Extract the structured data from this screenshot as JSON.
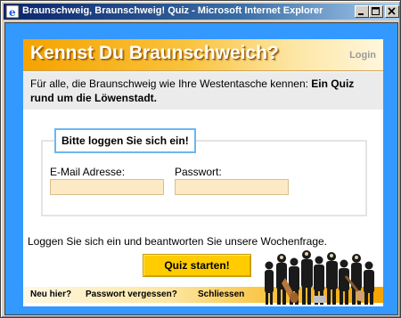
{
  "window": {
    "title": "Braunschweig, Braunschweig! Quiz - Microsoft Internet Explorer"
  },
  "header": {
    "title": "Kennst Du Braunschweich?",
    "login_link": "Login"
  },
  "intro": {
    "text": "Für alle, die Braunschweig wie Ihre Westentasche kennen: ",
    "bold": "Ein Quiz rund um die Löwenstadt."
  },
  "login": {
    "legend": "Bitte loggen Sie sich ein!",
    "email_label": "E-Mail Adresse:",
    "email_value": "",
    "password_label": "Passwort:",
    "password_value": ""
  },
  "prompt": "Loggen Sie sich ein und beantworten Sie unsere Wochenfrage.",
  "start_button": "Quiz starten!",
  "footer": {
    "links": [
      "Neu hier?",
      "Passwort vergessen?",
      "Schliessen"
    ]
  },
  "colors": {
    "frame_blue": "#3399ff",
    "accent_orange": "#f5a300",
    "button_yellow": "#ffcc00",
    "input_bg": "#fde9c3",
    "legend_border": "#6eb6f0"
  }
}
